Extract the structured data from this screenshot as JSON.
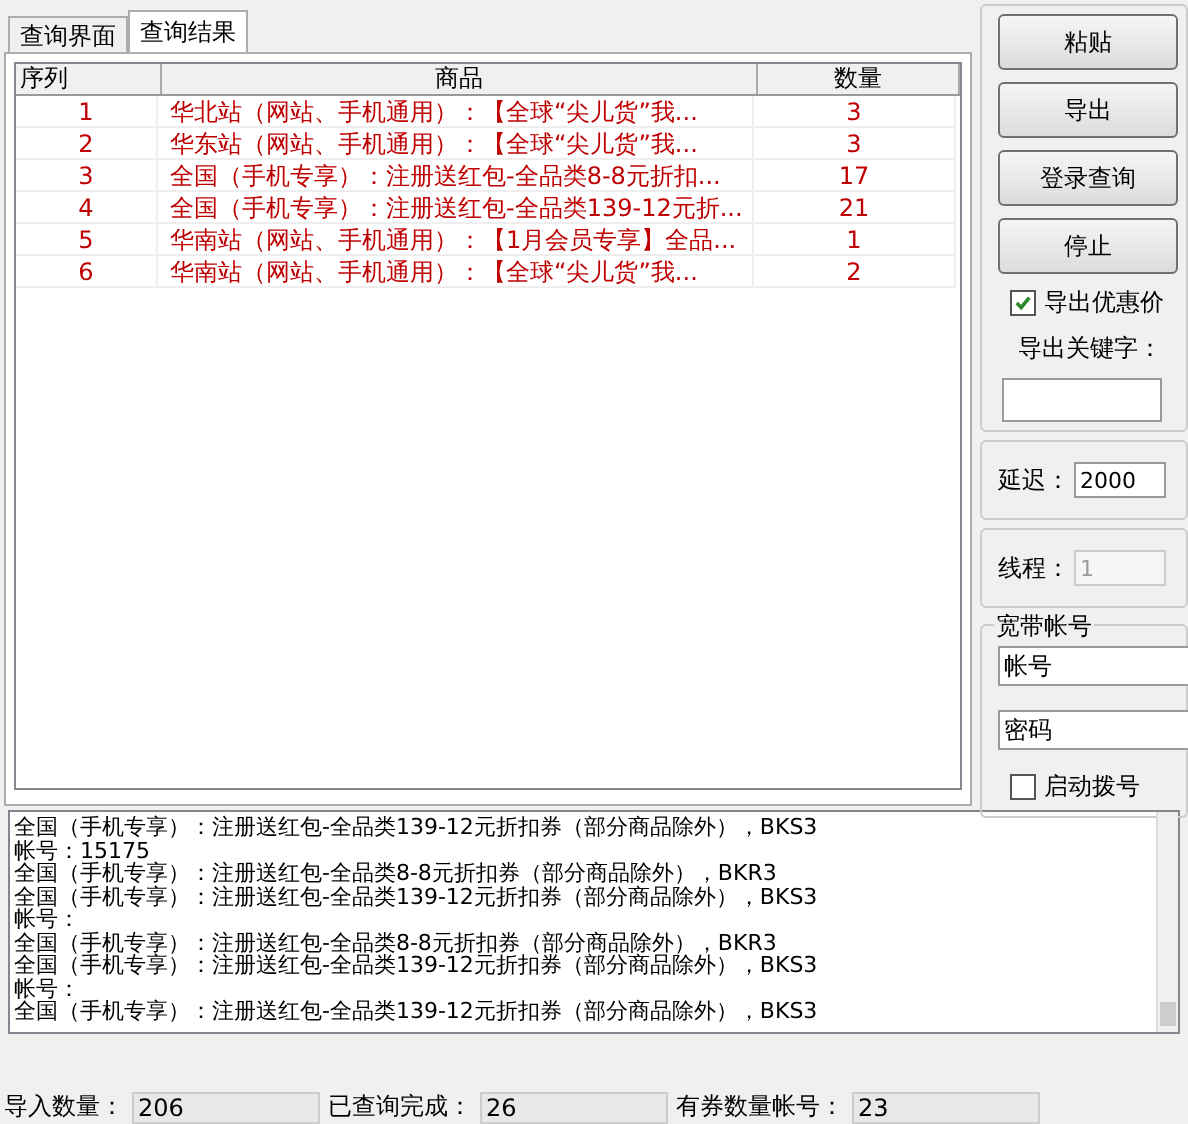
{
  "tabs": [
    {
      "label": "查询界面",
      "selected": false
    },
    {
      "label": "查询结果",
      "selected": true
    }
  ],
  "table": {
    "columns": [
      "序列",
      "商品",
      "数量"
    ],
    "rows": [
      {
        "index": "1",
        "product": "华北站（网站、手机通用）：【全球“尖儿货”我...",
        "count": "3"
      },
      {
        "index": "2",
        "product": "华东站（网站、手机通用）：【全球“尖儿货”我...",
        "count": "3"
      },
      {
        "index": "3",
        "product": "全国（手机专享）：注册送红包-全品类8-8元折扣...",
        "count": "17"
      },
      {
        "index": "4",
        "product": "全国（手机专享）：注册送红包-全品类139-12元折...",
        "count": "21"
      },
      {
        "index": "5",
        "product": "华南站（网站、手机通用）：【1月会员专享】全品...",
        "count": "1"
      },
      {
        "index": "6",
        "product": "华南站（网站、手机通用）：【全球“尖儿货”我...",
        "count": "2"
      }
    ]
  },
  "buttons": [
    "粘贴",
    "导出",
    "登录查询",
    "停止"
  ],
  "export_discount": {
    "label": "导出优惠价",
    "checked": true
  },
  "export_keyword": {
    "label": "导出关键字："
  },
  "delay": {
    "label": "延迟：",
    "value": "2000"
  },
  "threads": {
    "label": "线程：",
    "value": "1",
    "disabled": true
  },
  "broadband": {
    "title": "宽带帐号",
    "account": "帐号",
    "password": "密码",
    "auto_dial": {
      "label": "启动拨号",
      "checked": false
    }
  },
  "log": [
    "全国（手机专享）：注册送红包-全品类139-12元折扣券（部分商品除外），BKS3",
    "帐号：15175",
    "全国（手机专享）：注册送红包-全品类8-8元折扣券（部分商品除外），BKR3",
    "全国（手机专享）：注册送红包-全品类139-12元折扣券（部分商品除外），BKS3",
    "帐号：",
    "全国（手机专享）：注册送红包-全品类8-8元折扣券（部分商品除外），BKR3",
    "全国（手机专享）：注册送红包-全品类139-12元折扣券（部分商品除外），BKS3",
    "帐号：",
    "全国（手机专享）：注册送红包-全品类139-12元折扣券（部分商品除外），BKS3"
  ],
  "status_bar": [
    {
      "label": "导入数量：",
      "value": "206"
    },
    {
      "label": "已查询完成：",
      "value": "26"
    },
    {
      "label": "有券数量帐号：",
      "value": "23"
    }
  ]
}
